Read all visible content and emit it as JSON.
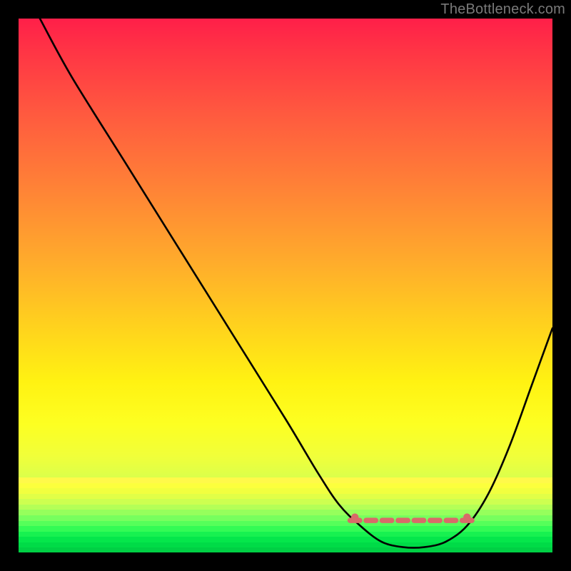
{
  "watermark": "TheBottleneck.com",
  "chart_data": {
    "type": "line",
    "title": "",
    "xlabel": "",
    "ylabel": "",
    "xlim": [
      0,
      100
    ],
    "ylim": [
      0,
      100
    ],
    "grid": false,
    "series": [
      {
        "name": "curve",
        "x": [
          4,
          10,
          20,
          30,
          40,
          50,
          56,
          60,
          64,
          68,
          72,
          76,
          80,
          84,
          88,
          92,
          96,
          100
        ],
        "values": [
          100,
          89,
          73,
          57,
          41,
          25,
          15,
          9,
          5,
          2,
          1,
          1,
          2,
          5,
          11,
          20,
          31,
          42
        ]
      }
    ],
    "annotations": {
      "flat_zone_markers_x": [
        63,
        66,
        69,
        72,
        75,
        78,
        81,
        84
      ],
      "flat_zone_y": 6,
      "marker_color": "#d86a69"
    },
    "background": {
      "type": "vertical_gradient",
      "stops": [
        {
          "pos": 0.0,
          "color": "#ff1f49"
        },
        {
          "pos": 0.18,
          "color": "#ff5a3f"
        },
        {
          "pos": 0.46,
          "color": "#ffad2b"
        },
        {
          "pos": 0.68,
          "color": "#fff212"
        },
        {
          "pos": 0.87,
          "color": "#d6ff4f"
        },
        {
          "pos": 1.0,
          "color": "#00e44c"
        }
      ]
    }
  }
}
